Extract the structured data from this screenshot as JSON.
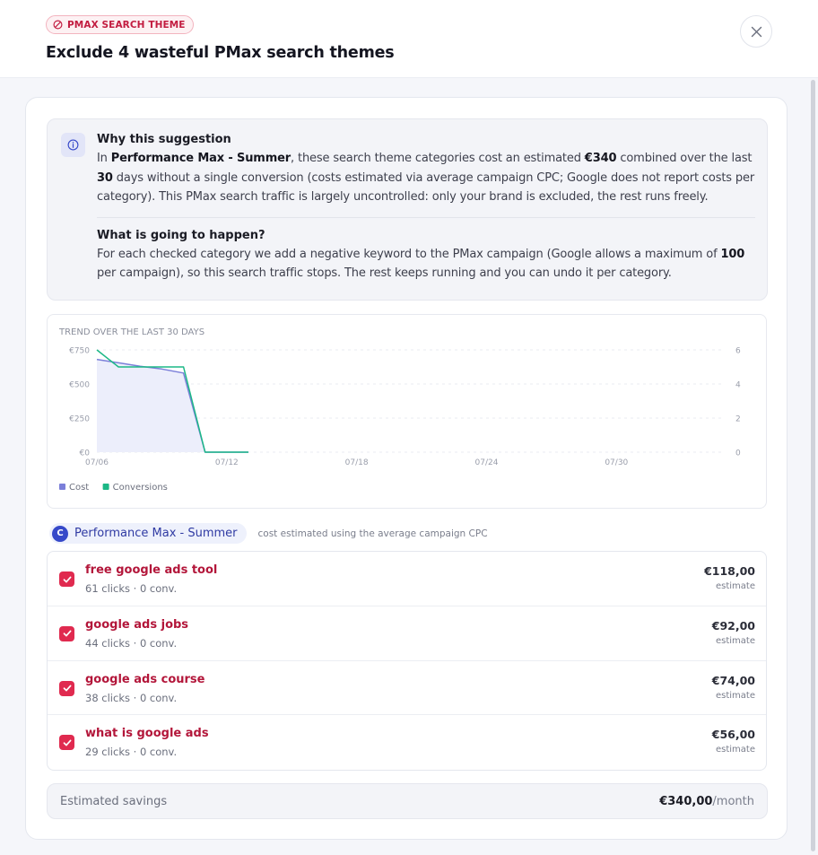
{
  "header": {
    "badge": "PMAX SEARCH THEME",
    "title": "Exclude 4 wasteful PMax search themes"
  },
  "info": {
    "why_heading": "Why this suggestion",
    "why_p1": "In ",
    "why_campaign": "Performance Max - Summer",
    "why_p2": ", these search theme categories cost an estimated ",
    "why_cost": "€340",
    "why_p3": " combined over the last ",
    "why_days": "30",
    "why_p4": " days without a single conversion (costs estimated via average campaign CPC; Google does not report costs per category). This PMax search traffic is largely uncontrolled: only your brand is excluded, the rest runs freely.",
    "what_heading": "What is going to happen?",
    "what_p1": "For each checked category we add a negative keyword to the PMax campaign (Google allows a maximum of ",
    "what_max": "100",
    "what_p2": " per campaign), so this search traffic stops. The rest keeps running and you can undo it per category."
  },
  "chart_data": {
    "type": "line",
    "title": "TREND OVER THE LAST 30 DAYS",
    "x_ticks": [
      "07/06",
      "07/12",
      "07/18",
      "07/24",
      "07/30"
    ],
    "y_left_ticks": [
      "€0",
      "€250",
      "€500",
      "€750"
    ],
    "y_right_ticks": [
      "0",
      "2",
      "4",
      "6"
    ],
    "ylim_left": [
      0,
      750
    ],
    "ylim_right": [
      0,
      6
    ],
    "grid": true,
    "series": [
      {
        "name": "Cost",
        "axis": "left",
        "color": "#7b7fd9",
        "fill": "#eceefb",
        "x": [
          0,
          1,
          2,
          3,
          4,
          5,
          6,
          7
        ],
        "values": [
          680,
          655,
          630,
          610,
          580,
          0,
          0,
          0
        ]
      },
      {
        "name": "Conversions",
        "axis": "right",
        "color": "#1cb886",
        "x": [
          0,
          1,
          2,
          3,
          4,
          5,
          6,
          7
        ],
        "values": [
          6,
          5,
          5,
          5,
          5,
          0,
          0,
          0
        ]
      }
    ],
    "legend_position": "bottom-left"
  },
  "campaign": {
    "initial": "C",
    "name": "Performance Max - Summer",
    "note": "cost estimated using the average campaign CPC"
  },
  "items": [
    {
      "name": "free google ads tool",
      "sub": "61 clicks · 0 conv.",
      "amount": "€118,00",
      "est": "estimate"
    },
    {
      "name": "google ads jobs",
      "sub": "44 clicks · 0 conv.",
      "amount": "€92,00",
      "est": "estimate"
    },
    {
      "name": "google ads course",
      "sub": "38 clicks · 0 conv.",
      "amount": "€74,00",
      "est": "estimate"
    },
    {
      "name": "what is google ads",
      "sub": "29 clicks · 0 conv.",
      "amount": "€56,00",
      "est": "estimate"
    }
  ],
  "savings": {
    "label": "Estimated savings",
    "value": "€340,00",
    "unit": "/month"
  },
  "colors": {
    "accent": "#e02a4f",
    "brand": "#3649c9",
    "cost": "#7b7fd9",
    "conversions": "#1cb886"
  }
}
